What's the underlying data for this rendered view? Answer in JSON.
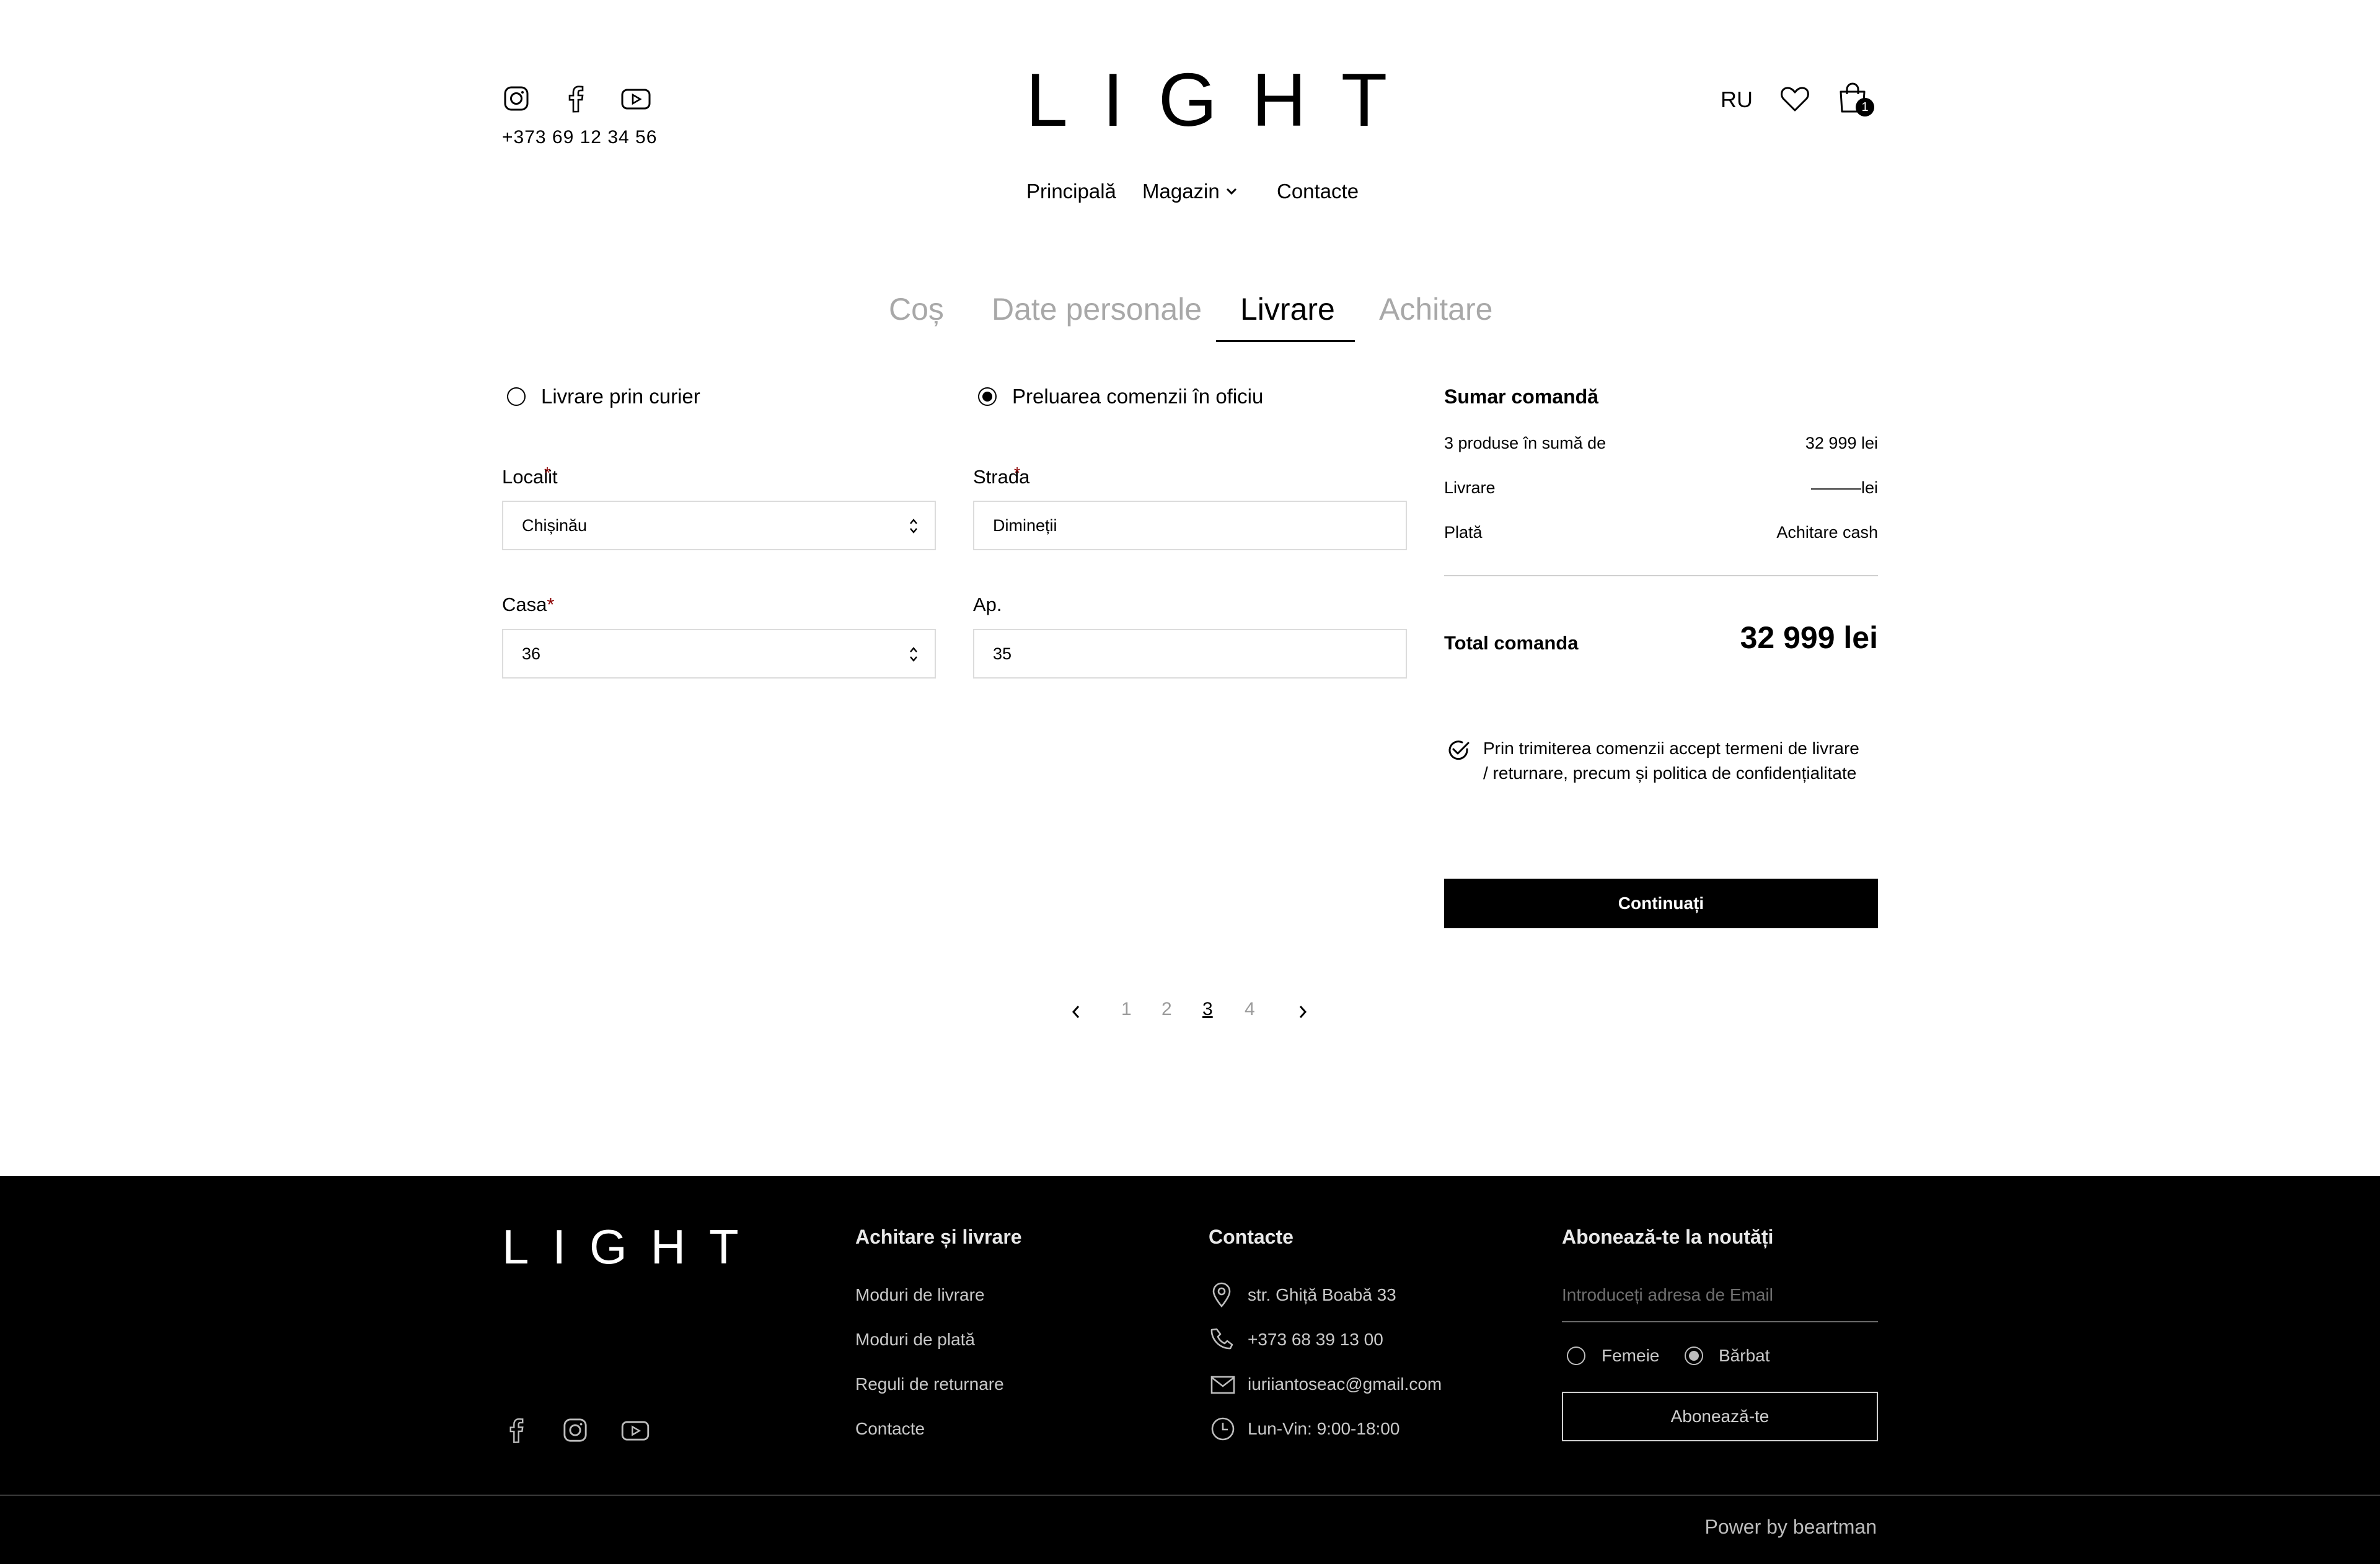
{
  "header": {
    "logo": "LIGHT",
    "phone": "+373 69 12 34 56",
    "language": "RU",
    "cart_count": "1",
    "social_icons": [
      "instagram-icon",
      "facebook-icon",
      "youtube-icon"
    ]
  },
  "nav": {
    "items": [
      "Principală",
      "Magazin",
      "Contacte"
    ]
  },
  "steps": {
    "items": [
      "Coș",
      "Date personale",
      "Livrare",
      "Achitare"
    ],
    "active": "Livrare"
  },
  "delivery": {
    "option_courier": "Livrare prin curier",
    "option_office": "Preluarea comenzii în oficiu",
    "selected": "Preluarea comenzii în oficiu",
    "locality_label": "Localit",
    "locality_value": "Chișinău",
    "street_label": "Strada",
    "street_value": "Dimineții",
    "house_label": "Casa",
    "house_value": "36",
    "apt_label": "Ap.",
    "apt_value": "35",
    "required_mark": "*"
  },
  "summary": {
    "title": "Sumar comandă",
    "products_label": "3 produse în sumă de",
    "products_value": "32 999 lei",
    "delivery_label": "Livrare",
    "delivery_value": "———lei",
    "payment_label": "Plată",
    "payment_value": "Achitare cash",
    "total_label": "Total comanda",
    "total_value": "32 999 lei",
    "terms_line1": "Prin trimiterea comenzii accept termeni de livrare",
    "terms_line2": "/ returnare, precum și politica de confidențialitate",
    "continue_label": "Continuați"
  },
  "pagination": {
    "pages": [
      "1",
      "2",
      "3",
      "4"
    ],
    "current": "3"
  },
  "footer": {
    "logo": "LIGHT",
    "col1_title": "Achitare și livrare",
    "col1_links": [
      "Moduri de livrare",
      "Moduri de plată",
      "Reguli de returnare",
      "Contacte"
    ],
    "col2_title": "Contacte",
    "address": "str. Ghiță Boabă 33",
    "phone": "+373 68 39 13 00",
    "email": "iuriiantoseac@gmail.com",
    "hours": "Lun-Vin: 9:00-18:00",
    "col3_title": "Abonează-te la noutăți",
    "email_placeholder": "Introduceți adresa de Email",
    "gender_female": "Femeie",
    "gender_male": "Bărbat",
    "gender_selected": "Bărbat",
    "subscribe_label": "Abonează-te",
    "power": "Power by beartman"
  },
  "colors": {
    "accent": "#000000",
    "muted": "#a8a8a8",
    "required": "#8b0000",
    "footer_bg": "#000000"
  }
}
